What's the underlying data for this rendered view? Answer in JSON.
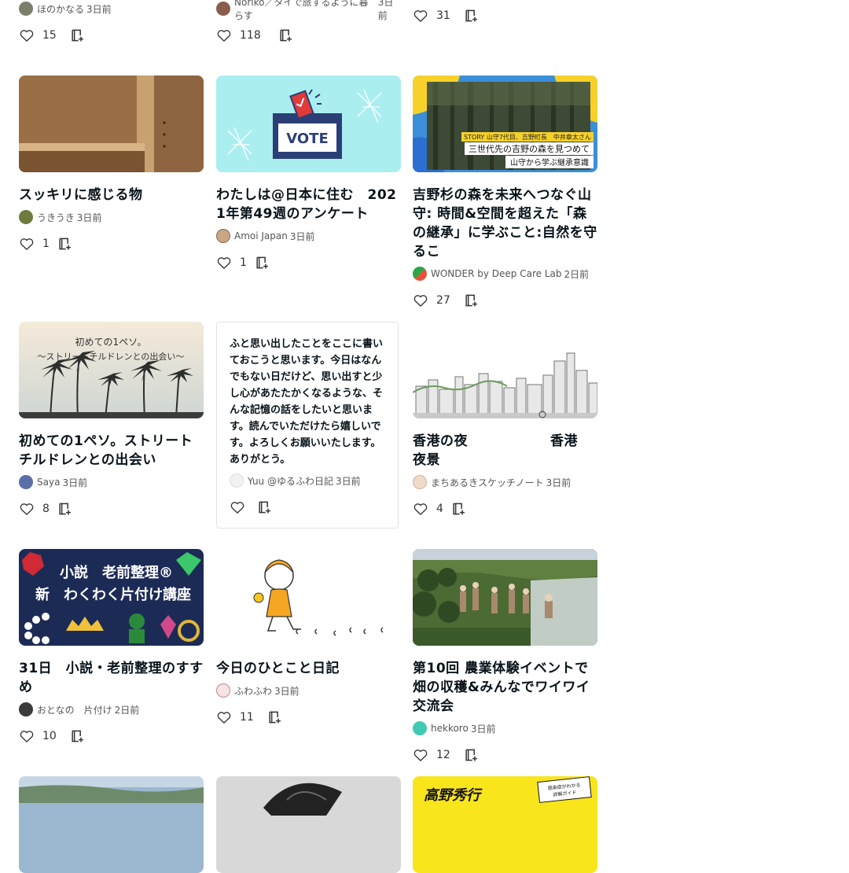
{
  "top_row": [
    {
      "author": "ほのかなる",
      "time": "3日前",
      "likes": "15"
    },
    {
      "author": "Noriko／タイで旅するように暮らす",
      "time": "3日前",
      "likes": "118"
    },
    {
      "author": "",
      "time": "",
      "likes": "31"
    }
  ],
  "row1": [
    {
      "title": "スッキリに感じる物",
      "author": "うきうき",
      "time": "3日前",
      "likes": "1"
    },
    {
      "title": "わたしは@日本に住む　2021年第49週のアンケート",
      "author": "Amoi Japan",
      "time": "3日前",
      "likes": "1",
      "thumb_text": "VOTE"
    },
    {
      "title": "吉野杉の森を未来へつなぐ山守: 時間&空間を超えた「森の継承」に学ぶこと:自然を守るこ",
      "author": "WONDER by Deep Care Lab",
      "time": "2日前",
      "likes": "27",
      "thumb_text": [
        "STORY 山守7代目、吉野町長　中井章太さん",
        "三世代先の吉野の森を見つめて",
        "山守から学ぶ継承意識"
      ]
    }
  ],
  "row2": [
    {
      "title": "初めての1ペソ。ストリートチルドレンとの出会い",
      "author": "Saya",
      "time": "3日前",
      "likes": "8",
      "thumb_text": [
        "初めての1ペソ。",
        "〜ストリートチルドレンとの出会い〜"
      ]
    },
    {
      "text_body": "ふと思い出したことをここに書いておこうと思います。今日はなんでもない日だけど、思い出すと少し心があたたかくなるような、そんな記憶の話をしたいと思います。読んでいただけたら嬉しいです。よろしくお願いいたします。ありがとう。",
      "author": "Yuu @ゆるふわ日記",
      "time": "3日前",
      "likes": ""
    },
    {
      "title": "香港の夜　　　　　　香港　夜景",
      "author": "まちあるきスケッチノート",
      "time": "3日前",
      "likes": "4"
    }
  ],
  "row3": [
    {
      "title": "31日　小説・老前整理のすすめ",
      "author": "おとなの　片付け",
      "time": "2日前",
      "likes": "10",
      "thumb_text": [
        "小説　老前整理®",
        "新　わくわく片付け講座"
      ]
    },
    {
      "title": "今日のひとこと日記",
      "author": "ふわふわ",
      "time": "3日前",
      "likes": "11"
    },
    {
      "title": "第10回 農業体験イベントで畑の収穫&みんなでワイワイ交流会",
      "author": "hekkoro",
      "time": "3日前",
      "likes": "12"
    }
  ],
  "row4": [
    {},
    {},
    {
      "thumb_text": [
        "高野秀行",
        "感染症がわかる",
        "詳解ガイド"
      ]
    }
  ],
  "colors": {
    "like_icon": "#333333",
    "accent": "#e5335a",
    "brand": "#41c9b4"
  },
  "icons": {
    "like": "heart-icon",
    "magazine": "magazine-add-icon"
  }
}
